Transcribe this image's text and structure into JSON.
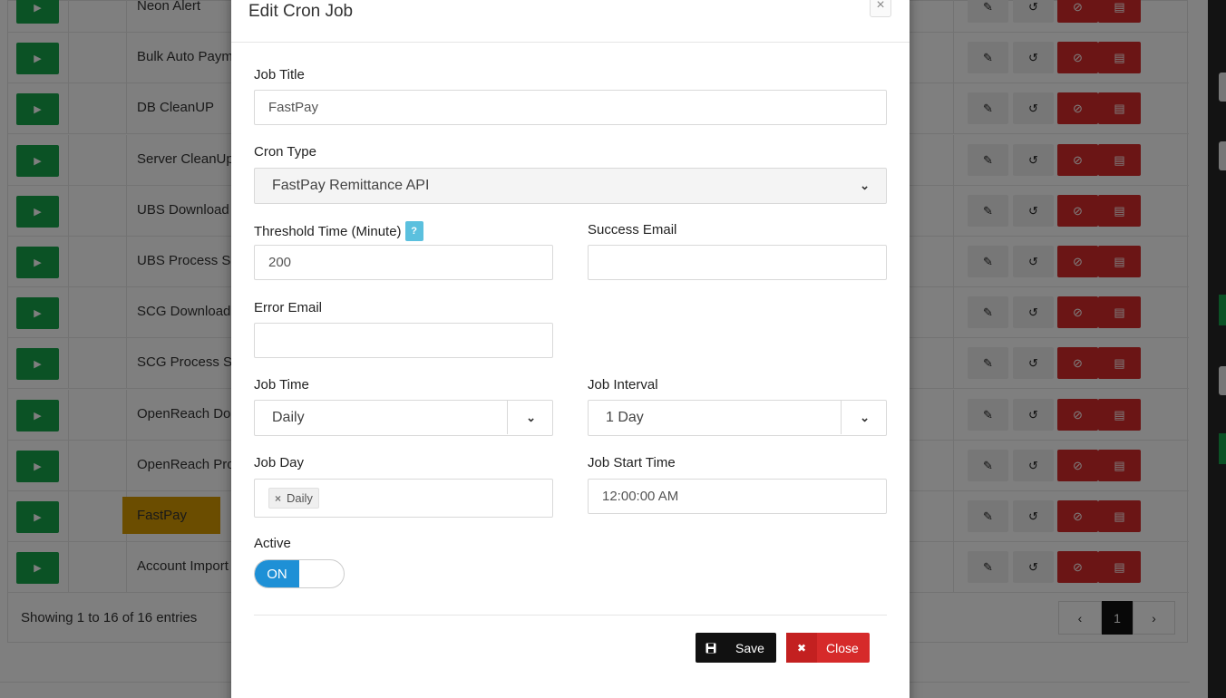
{
  "background": {
    "rows": [
      {
        "name": "Neon Alert"
      },
      {
        "name": "Bulk Auto Paym"
      },
      {
        "name": "DB CleanUP"
      },
      {
        "name": "Server CleanUp"
      },
      {
        "name": "UBS Download"
      },
      {
        "name": "UBS Process S"
      },
      {
        "name": "SCG Download"
      },
      {
        "name": "SCG Process S"
      },
      {
        "name": "OpenReach Do"
      },
      {
        "name": "OpenReach Pro"
      },
      {
        "name": "FastPay"
      },
      {
        "name": "Account Import"
      }
    ],
    "footer_text": "Showing 1 to 16 of 16 entries",
    "pagination": {
      "prev": "‹",
      "current": "1",
      "next": "›"
    },
    "icons": {
      "play": "play-icon",
      "edit": "pencil-icon",
      "history": "history-icon",
      "block": "ban-icon",
      "delete": "trash-icon"
    },
    "colors": {
      "play": "#17a54a",
      "danger": "#d62a2a",
      "highlight": "#d79b00"
    }
  },
  "modal": {
    "title": "Edit Cron Job",
    "close_x": "×",
    "job_title": {
      "label": "Job Title",
      "value": "FastPay"
    },
    "cron_type": {
      "label": "Cron Type",
      "value": "FastPay Remittance API"
    },
    "threshold": {
      "label": "Threshold Time (Minute)",
      "help": "?",
      "value": "200"
    },
    "success_email": {
      "label": "Success Email",
      "value": ""
    },
    "error_email": {
      "label": "Error Email",
      "value": ""
    },
    "job_time": {
      "label": "Job Time",
      "value": "Daily"
    },
    "job_interval": {
      "label": "Job Interval",
      "value": "1 Day"
    },
    "job_day": {
      "label": "Job Day",
      "tag": "Daily",
      "tag_remove": "×"
    },
    "job_start_time": {
      "label": "Job Start Time",
      "value": "12:00:00 AM"
    },
    "active": {
      "label": "Active",
      "state": "ON"
    },
    "buttons": {
      "save": "Save",
      "close": "Close"
    },
    "colors": {
      "toggle_on": "#1e90d6",
      "help_badge": "#5bc0de",
      "save": "#111111",
      "close": "#d62a2a"
    }
  }
}
